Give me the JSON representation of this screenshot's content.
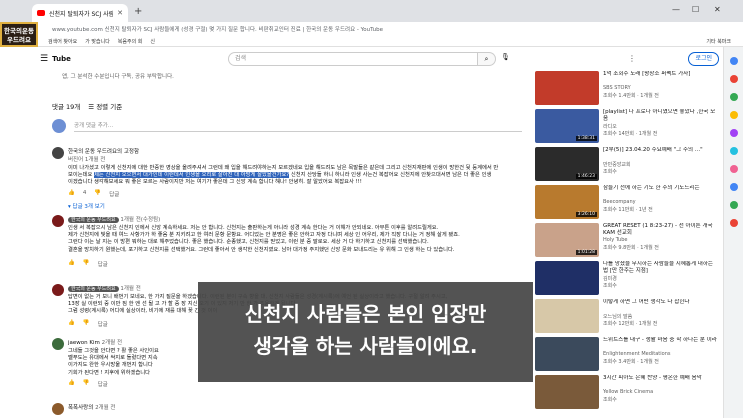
{
  "browser": {
    "tab_title": "신천지 탈퇴자가 SCJ 사람들에게...",
    "new_tab": "+",
    "url": "www.youtube.com  신천지 탈퇴자가 SCJ 사람들에게 (성경 구절) 몇 가지 질문 합니다. 비판취교인터 진료 | 한국의 운동 우드려요 - YouTube",
    "bookmarks": [
      "검색어 찾아요",
      "가 맞습니다",
      "복음주의 회",
      "신 "
    ],
    "bookmarks_right": "기타 북마크"
  },
  "channel_logo": {
    "line1": "한국의운동",
    "line2": "우드려요"
  },
  "yt": {
    "logo_text": "Tube",
    "search_placeholder": "검색",
    "login_label": "로그인"
  },
  "main": {
    "top_desc": "앱, 그 분석한 수분입니다 구독, 공유 부탁합니다.",
    "comment_count": "댓글 19개",
    "sort_label": "정렬 기준",
    "add_comment_placeholder": "공개 댓글 추가...",
    "comments": [
      {
        "author": "한국의 운동 우드려요의 고정함",
        "meta": "버진어 1개월 전",
        "text_lines": [
          "이미 나가셨고 이렇게 신천지에 대한 반증한 영상을 올려주셔서 그런데 왜 입을 해드려야하는지 모르겠네요 입을 해드려도 남은 목말들은 같은데 그리고 신천지재판에 인생이 망한건 뒷 등계에서 만",
          "보이는데요 |HL|제는 신천지 오으면서 대가인데 이런데서 인생을 오리로 살아진 대 아망게 살았을건가요?|/HL| 신천지 산당들 하니 하니라 인생 사는건 복잡어요 신천지에 안찾으대서면 남은 더 좋은 인생",
          "이겠습니다 생각해보세요 뭐 좋은 모르는 사람이지만 저는 여기가 좋은데 그 신앙 계속 합니다 해나! 안녕히. 잘 알았어요 복잡요사 !!!"
        ],
        "likes": "4",
        "reply_label": "답글",
        "replies_label": "답글 3개 보기"
      },
      {
        "author": "한국의 운동 우드려요",
        "meta": "1개월 전(수정됨)",
        "text_lines": [
          "인생 서 복잡으시 남은 신천지 인에서 신앙 계속하세요. 저는 안 합니다. 신천지는 출판하는게 아니라 성경 계속 한다는 거 이해가 안되네요. 아무튼 이후를 알려드릴게요.",
          "제가 신천지에 빛을 때 여느 사항가가 하 좋음 분 지키려고 한 여러 문항 문항요. 어디었는 안 분명은 좋은 안하고 자정 다니며 세상 인 어우리, 제가 직장 다니는 거 정해 살게 됐죠.",
          "그런다 이는 날 지는 이 방편 뭐하는 대로 해주었습니다. 좋은 했습니다. 순종했고, 신천지를 믿었고, 이런 분 중 말로요. 세상 거 다 하기하고 신천지를 선택했습니다.",
          "결혼을 망치하기 원했는데, 포기하고 신천지를 선택했거요. 그런데 좋아서 안 생각한 신천지였요. 남아 대가정 주지했던 신앙 문화 보내드리는 유 위해 그 인생 하는 다 있습니다."
        ],
        "likes": "",
        "reply_label": "답글"
      },
      {
        "author": "한국의 운동 우드려요",
        "meta": "1개월 전",
        "text_lines": [
          "답변이 없는 거 보니 배번기 보네요, 한 가지 질문을 하겠습니다. 이런된 분이 구속 향을 대, 신천지 사람들은 성경(계시록)에 예언 된 실상이라고 했습니다. 구절 알려 주시고,",
          "13장 실 이런되 중 이만 짐 한 엔 선 될 고 가 할 중 장 지신 오기 이 있지 저기 만 한 가 조용하게 됩니다",
          "그럼 성령(계시록) 어디에 실상이라, 비기에 재를 대해 꽂 긴 것 이이"
        ],
        "likes": "",
        "reply_label": "답글"
      },
      {
        "author": "jaewon Kim",
        "meta": "2개월 전",
        "text_lines": [
          "그네들 그것을 안다면 ? 활 좋은 사인이요",
          "벨푸도는 유대에서 싹지로 돌렸다면 지속",
          "이가지도 완한 우시망울 개번지 합니다",
          "기회가 된다면 ! 지후에 위하겠습니다"
        ],
        "likes": "",
        "reply_label": "답글"
      },
      {
        "author": "폭폭사랑의",
        "meta": "2개월 전",
        "text_lines": [],
        "likes": "",
        "reply_label": ""
      }
    ]
  },
  "subtitle": {
    "line1": "신천지 사람들은 본인 입장만",
    "line2": "생각을 하는 사람들이에요."
  },
  "sidebar": {
    "videos": [
      {
        "title": "1억 조회수 노래 [왕장소 퍼펙트 가사]",
        "channel": "SBS STORY",
        "meta": "조회수 1.4만회 · 1개월 전",
        "duration": "",
        "thumb_color": "#c23b2a"
      },
      {
        "title": "[playlist] 나 프로나 아니였으면 좋았다 ,한국 모음",
        "channel": "라디오",
        "meta": "조회수 14만회 · 1개월 전",
        "duration": "1:38:31",
        "thumb_color": "#3a5aa0"
      },
      {
        "title": "[2부(5)] 23.04.20 수요예배 \"그 주의 ...\"",
        "channel": "만민중앙교회",
        "meta": "조회수 ",
        "duration": "1:46:23",
        "thumb_color": "#2b2b2b"
      },
      {
        "title": "잠들기 전에 하는 기도 한 주의 기도드리는",
        "channel": "Beecompany",
        "meta": "조회수 11만회 · 1년 전",
        "duration": "3:26:10",
        "thumb_color": "#b87a2e"
      },
      {
        "title": "GREAT RESET (1 8:23-27) - 선 아이튼 개국 KAM 선교회",
        "channel": "Holy Tube",
        "meta": "조회수 9.8만회 · 1개월 전",
        "duration": "1:01:28",
        "thumb_color": "#c9a28a"
      },
      {
        "title": "나를 망쳤을 무시하는 사람들을 지혜롭게 대하는 법 [만 한주는 지점]",
        "channel": "김미경",
        "meta": "조회수 ",
        "duration": "",
        "thumb_color": "#1f2f66"
      },
      {
        "title": "이렇게 하면 그 어떤 생각도 다 잡힌다",
        "channel": "오느님의 말씀",
        "meta": "조회수 12만회 · 1개월 전",
        "duration": "",
        "thumb_color": "#d7c8a8"
      },
      {
        "title": "드위트스를 내구 - 생활 마음 중 학 하나는 분 이라",
        "channel": "Enlightenment Meditations",
        "meta": "조회수 3.4만회 · 1개월 전",
        "duration": "",
        "thumb_color": "#3b4a5c"
      },
      {
        "title": "3시간 피아노 은혜 찬양 - 평온한 예배 음악",
        "channel": "Yellow Brick Cinema",
        "meta": "조회수 ",
        "duration": "",
        "thumb_color": "#7a5a3a"
      }
    ]
  },
  "colors": {
    "accent": "#065fd4",
    "highlight": "#2f63ba",
    "yt_red": "#ff0000"
  }
}
